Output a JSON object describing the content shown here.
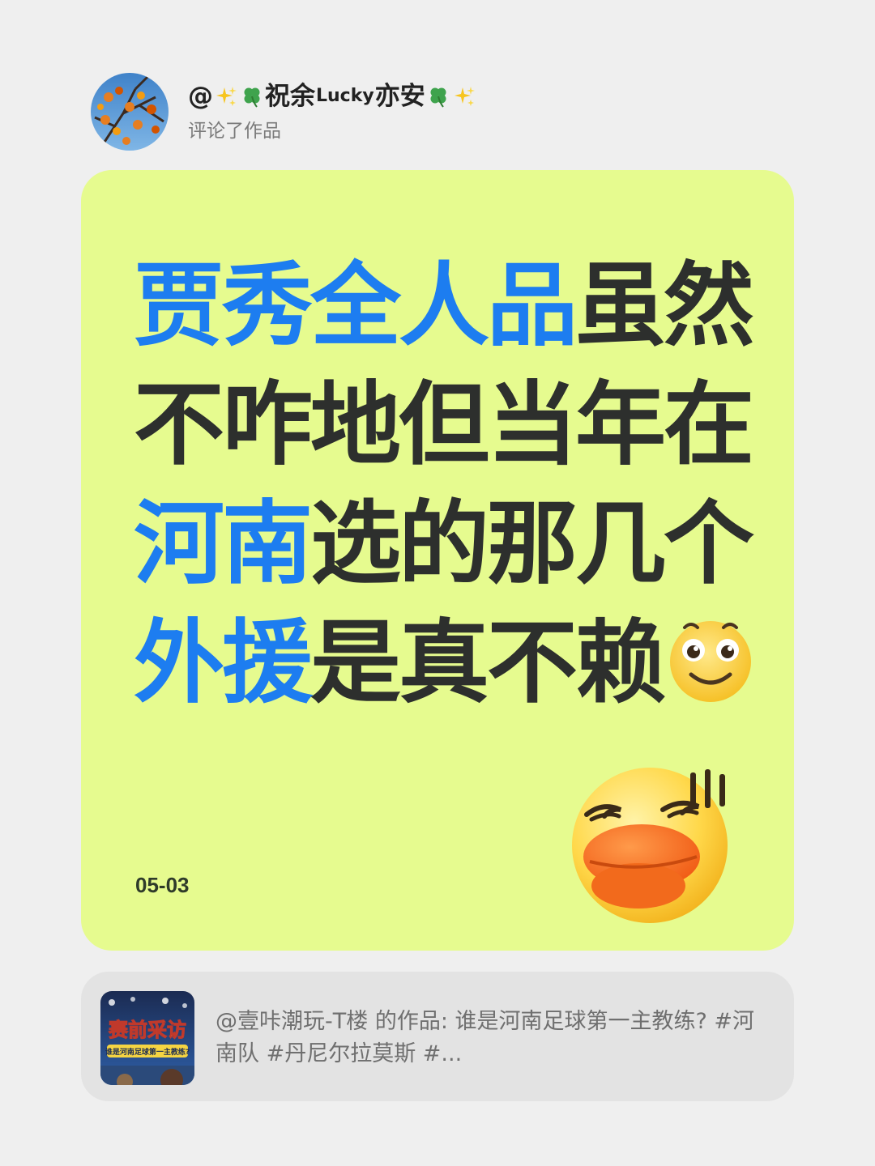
{
  "author": {
    "at_sign": "@",
    "name_part1": "祝余",
    "name_lucky": "Lucky",
    "name_part2": "亦安",
    "emoji_decorations": [
      "sparkles-icon",
      "four-leaf-clover-icon"
    ],
    "action": "评论了作品"
  },
  "comment": {
    "line1_highlight": "贾秀全人品",
    "line1_rest": "虽然",
    "line2": "不咋地但当年在",
    "line3_highlight": "河南",
    "line3_rest": "选的那几个",
    "line4_highlight": "外援",
    "line4_rest": "是真不赖",
    "trailing_emoji": "smiling-face-icon",
    "sticker": "duck-face-sticker"
  },
  "date": "05-03",
  "referenced_work": {
    "thumbnail_title": "赛前采访",
    "thumbnail_subtitle": "谁是河南足球第一主教练?",
    "text": "@壹咔潮玩-T楼 的作品: 谁是河南足球第一主教练? #河南队 #丹尼尔拉莫斯 #..."
  },
  "colors": {
    "background": "#efefef",
    "card_background": "#e6fb8f",
    "highlight_blue": "#1d7df0",
    "text_dark": "#2d2f2d",
    "ref_card_background": "#e3e3e3"
  }
}
